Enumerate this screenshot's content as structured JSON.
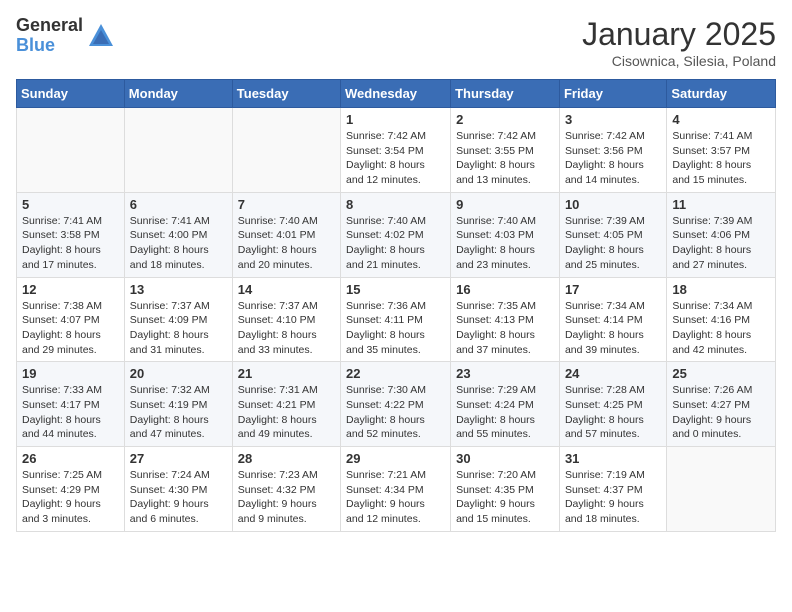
{
  "logo": {
    "general": "General",
    "blue": "Blue"
  },
  "header": {
    "month": "January 2025",
    "location": "Cisownica, Silesia, Poland"
  },
  "weekdays": [
    "Sunday",
    "Monday",
    "Tuesday",
    "Wednesday",
    "Thursday",
    "Friday",
    "Saturday"
  ],
  "weeks": [
    [
      {
        "day": "",
        "info": ""
      },
      {
        "day": "",
        "info": ""
      },
      {
        "day": "",
        "info": ""
      },
      {
        "day": "1",
        "info": "Sunrise: 7:42 AM\nSunset: 3:54 PM\nDaylight: 8 hours\nand 12 minutes."
      },
      {
        "day": "2",
        "info": "Sunrise: 7:42 AM\nSunset: 3:55 PM\nDaylight: 8 hours\nand 13 minutes."
      },
      {
        "day": "3",
        "info": "Sunrise: 7:42 AM\nSunset: 3:56 PM\nDaylight: 8 hours\nand 14 minutes."
      },
      {
        "day": "4",
        "info": "Sunrise: 7:41 AM\nSunset: 3:57 PM\nDaylight: 8 hours\nand 15 minutes."
      }
    ],
    [
      {
        "day": "5",
        "info": "Sunrise: 7:41 AM\nSunset: 3:58 PM\nDaylight: 8 hours\nand 17 minutes."
      },
      {
        "day": "6",
        "info": "Sunrise: 7:41 AM\nSunset: 4:00 PM\nDaylight: 8 hours\nand 18 minutes."
      },
      {
        "day": "7",
        "info": "Sunrise: 7:40 AM\nSunset: 4:01 PM\nDaylight: 8 hours\nand 20 minutes."
      },
      {
        "day": "8",
        "info": "Sunrise: 7:40 AM\nSunset: 4:02 PM\nDaylight: 8 hours\nand 21 minutes."
      },
      {
        "day": "9",
        "info": "Sunrise: 7:40 AM\nSunset: 4:03 PM\nDaylight: 8 hours\nand 23 minutes."
      },
      {
        "day": "10",
        "info": "Sunrise: 7:39 AM\nSunset: 4:05 PM\nDaylight: 8 hours\nand 25 minutes."
      },
      {
        "day": "11",
        "info": "Sunrise: 7:39 AM\nSunset: 4:06 PM\nDaylight: 8 hours\nand 27 minutes."
      }
    ],
    [
      {
        "day": "12",
        "info": "Sunrise: 7:38 AM\nSunset: 4:07 PM\nDaylight: 8 hours\nand 29 minutes."
      },
      {
        "day": "13",
        "info": "Sunrise: 7:37 AM\nSunset: 4:09 PM\nDaylight: 8 hours\nand 31 minutes."
      },
      {
        "day": "14",
        "info": "Sunrise: 7:37 AM\nSunset: 4:10 PM\nDaylight: 8 hours\nand 33 minutes."
      },
      {
        "day": "15",
        "info": "Sunrise: 7:36 AM\nSunset: 4:11 PM\nDaylight: 8 hours\nand 35 minutes."
      },
      {
        "day": "16",
        "info": "Sunrise: 7:35 AM\nSunset: 4:13 PM\nDaylight: 8 hours\nand 37 minutes."
      },
      {
        "day": "17",
        "info": "Sunrise: 7:34 AM\nSunset: 4:14 PM\nDaylight: 8 hours\nand 39 minutes."
      },
      {
        "day": "18",
        "info": "Sunrise: 7:34 AM\nSunset: 4:16 PM\nDaylight: 8 hours\nand 42 minutes."
      }
    ],
    [
      {
        "day": "19",
        "info": "Sunrise: 7:33 AM\nSunset: 4:17 PM\nDaylight: 8 hours\nand 44 minutes."
      },
      {
        "day": "20",
        "info": "Sunrise: 7:32 AM\nSunset: 4:19 PM\nDaylight: 8 hours\nand 47 minutes."
      },
      {
        "day": "21",
        "info": "Sunrise: 7:31 AM\nSunset: 4:21 PM\nDaylight: 8 hours\nand 49 minutes."
      },
      {
        "day": "22",
        "info": "Sunrise: 7:30 AM\nSunset: 4:22 PM\nDaylight: 8 hours\nand 52 minutes."
      },
      {
        "day": "23",
        "info": "Sunrise: 7:29 AM\nSunset: 4:24 PM\nDaylight: 8 hours\nand 55 minutes."
      },
      {
        "day": "24",
        "info": "Sunrise: 7:28 AM\nSunset: 4:25 PM\nDaylight: 8 hours\nand 57 minutes."
      },
      {
        "day": "25",
        "info": "Sunrise: 7:26 AM\nSunset: 4:27 PM\nDaylight: 9 hours\nand 0 minutes."
      }
    ],
    [
      {
        "day": "26",
        "info": "Sunrise: 7:25 AM\nSunset: 4:29 PM\nDaylight: 9 hours\nand 3 minutes."
      },
      {
        "day": "27",
        "info": "Sunrise: 7:24 AM\nSunset: 4:30 PM\nDaylight: 9 hours\nand 6 minutes."
      },
      {
        "day": "28",
        "info": "Sunrise: 7:23 AM\nSunset: 4:32 PM\nDaylight: 9 hours\nand 9 minutes."
      },
      {
        "day": "29",
        "info": "Sunrise: 7:21 AM\nSunset: 4:34 PM\nDaylight: 9 hours\nand 12 minutes."
      },
      {
        "day": "30",
        "info": "Sunrise: 7:20 AM\nSunset: 4:35 PM\nDaylight: 9 hours\nand 15 minutes."
      },
      {
        "day": "31",
        "info": "Sunrise: 7:19 AM\nSunset: 4:37 PM\nDaylight: 9 hours\nand 18 minutes."
      },
      {
        "day": "",
        "info": ""
      }
    ]
  ]
}
